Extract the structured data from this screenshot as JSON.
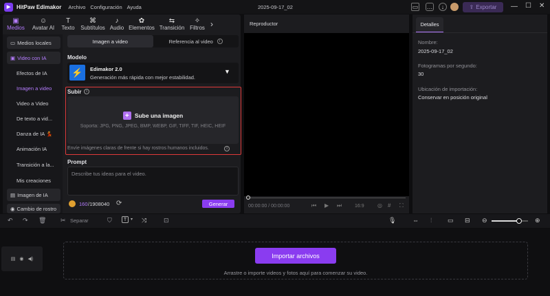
{
  "app": {
    "name": "HitPaw Edimakor",
    "project_title": "2025-09-17_02",
    "export_label": "Exportar"
  },
  "menu": [
    "Archivo",
    "Configuración",
    "Ayuda"
  ],
  "tools": [
    {
      "label": "Medios",
      "icon": "media-icon"
    },
    {
      "label": "Avatar AI",
      "icon": "avatar-icon"
    },
    {
      "label": "Texto",
      "icon": "text-icon"
    },
    {
      "label": "Subtítulos",
      "icon": "subtitles-icon"
    },
    {
      "label": "Audio",
      "icon": "audio-icon"
    },
    {
      "label": "Elementos",
      "icon": "elements-icon"
    },
    {
      "label": "Transición",
      "icon": "transition-icon"
    },
    {
      "label": "Filtros",
      "icon": "filters-icon"
    }
  ],
  "sidebar": {
    "items": [
      {
        "label": "Medios locales"
      },
      {
        "label": "Video con IA"
      },
      {
        "label": "Efectos de IA"
      },
      {
        "label": "Imagen a video"
      },
      {
        "label": "Video a Video"
      },
      {
        "label": "De texto a vid..."
      },
      {
        "label": "Danza de IA 💃"
      },
      {
        "label": "Animación IA"
      },
      {
        "label": "Transición a la..."
      },
      {
        "label": "Mis creaciones"
      },
      {
        "label": "Imagen de IA"
      },
      {
        "label": "Cambio de rostro"
      }
    ]
  },
  "generator": {
    "tabs": [
      "Imagen a video",
      "Referencia al video"
    ],
    "model_label": "Modelo",
    "model_name": "Edimakor 2.0",
    "model_desc": "Generación más rápida con mejor estabilidad.",
    "upload_label": "Subir",
    "upload_button": "Sube una imagen",
    "upload_formats": "Soporta: JPG, PNG, JPEG, BMP, WEBP, GIF, TIFF, TIF, HEIC, HEIF",
    "upload_hint": "Envíe imágenes claras de frente si hay rostros humanos incluidos.",
    "prompt_label": "Prompt",
    "prompt_placeholder": "Describe tus ideas para el video.",
    "credits_used": "160",
    "credits_total": "/1908040",
    "generate_label": "Generar"
  },
  "player": {
    "title": "Reproductor",
    "time": "00:00:00 / 00:00:00",
    "ratio": "16:9"
  },
  "details": {
    "tab": "Detalles",
    "fields": [
      {
        "label": "Nombre:",
        "value": "2025-09-17_02"
      },
      {
        "label": "Fotogramas por segundo:",
        "value": "30"
      },
      {
        "label": "Ubicación de importación:",
        "value": "Conservar en posición original"
      }
    ]
  },
  "timeline": {
    "split_label": "Separar",
    "import_button": "Importar archivos",
    "import_hint": "Arrastre o importe videos y fotos aquí para comenzar su video.",
    "zoom_level": 0.75
  },
  "colors": {
    "accent": "#8a3cf0",
    "accent_text": "#b57cff",
    "highlight_border": "#e03a3a"
  }
}
